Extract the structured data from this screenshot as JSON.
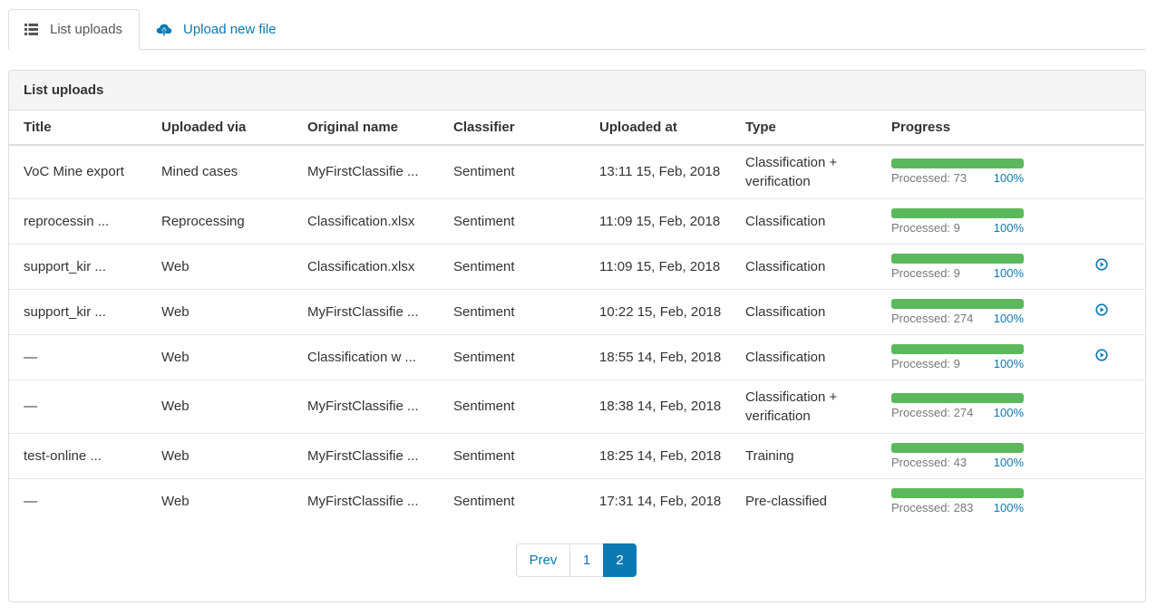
{
  "tabs": {
    "list": {
      "label": "List uploads",
      "icon": "list-icon"
    },
    "upload": {
      "label": "Upload new file",
      "icon": "cloud-upload-icon"
    }
  },
  "panel": {
    "title": "List uploads"
  },
  "table": {
    "headers": [
      "Title",
      "Uploaded via",
      "Original name",
      "Classifier",
      "Uploaded at",
      "Type",
      "Progress"
    ],
    "rows": [
      {
        "title": "VoC Mine export",
        "via": "Mined cases",
        "original": "MyFirstClassifie ...",
        "classifier": "Sentiment",
        "uploaded_at": "13:11 15, Feb, 2018",
        "type": "Classification + verification",
        "processed": "Processed: 73",
        "pct": "100%",
        "progress": 1.0,
        "play": false
      },
      {
        "title": "reprocessin ...",
        "via": "Reprocessing",
        "original": "Classification.xlsx",
        "classifier": "Sentiment",
        "uploaded_at": "11:09 15, Feb, 2018",
        "type": "Classification",
        "processed": "Processed: 9",
        "pct": "100%",
        "progress": 1.0,
        "play": false
      },
      {
        "title": "support_kir ...",
        "via": "Web",
        "original": "Classification.xlsx",
        "classifier": "Sentiment",
        "uploaded_at": "11:09 15, Feb, 2018",
        "type": "Classification",
        "processed": "Processed: 9",
        "pct": "100%",
        "progress": 1.0,
        "play": true
      },
      {
        "title": "support_kir ...",
        "via": "Web",
        "original": "MyFirstClassifie ...",
        "classifier": "Sentiment",
        "uploaded_at": "10:22 15, Feb, 2018",
        "type": "Classification",
        "processed": "Processed: 274",
        "pct": "100%",
        "progress": 1.0,
        "play": true
      },
      {
        "title": "—",
        "via": "Web",
        "original": "Classification w ...",
        "classifier": "Sentiment",
        "uploaded_at": "18:55 14, Feb, 2018",
        "type": "Classification",
        "processed": "Processed: 9",
        "pct": "100%",
        "progress": 1.0,
        "play": true
      },
      {
        "title": "—",
        "via": "Web",
        "original": "MyFirstClassifie ...",
        "classifier": "Sentiment",
        "uploaded_at": "18:38 14, Feb, 2018",
        "type": "Classification + verification",
        "processed": "Processed: 274",
        "pct": "100%",
        "progress": 1.0,
        "play": false
      },
      {
        "title": "test-online ...",
        "via": "Web",
        "original": "MyFirstClassifie ...",
        "classifier": "Sentiment",
        "uploaded_at": "18:25 14, Feb, 2018",
        "type": "Training",
        "processed": "Processed: 43",
        "pct": "100%",
        "progress": 1.0,
        "play": false
      },
      {
        "title": "—",
        "via": "Web",
        "original": "MyFirstClassifie ...",
        "classifier": "Sentiment",
        "uploaded_at": "17:31 14, Feb, 2018",
        "type": "Pre-classified",
        "processed": "Processed: 283",
        "pct": "100%",
        "progress": 1.0,
        "play": false
      }
    ]
  },
  "pagination": {
    "prev": "Prev",
    "pages": [
      "1",
      "2"
    ],
    "current": "2"
  },
  "colors": {
    "accent": "#0b7ab2",
    "progress": "#5cb85c"
  }
}
